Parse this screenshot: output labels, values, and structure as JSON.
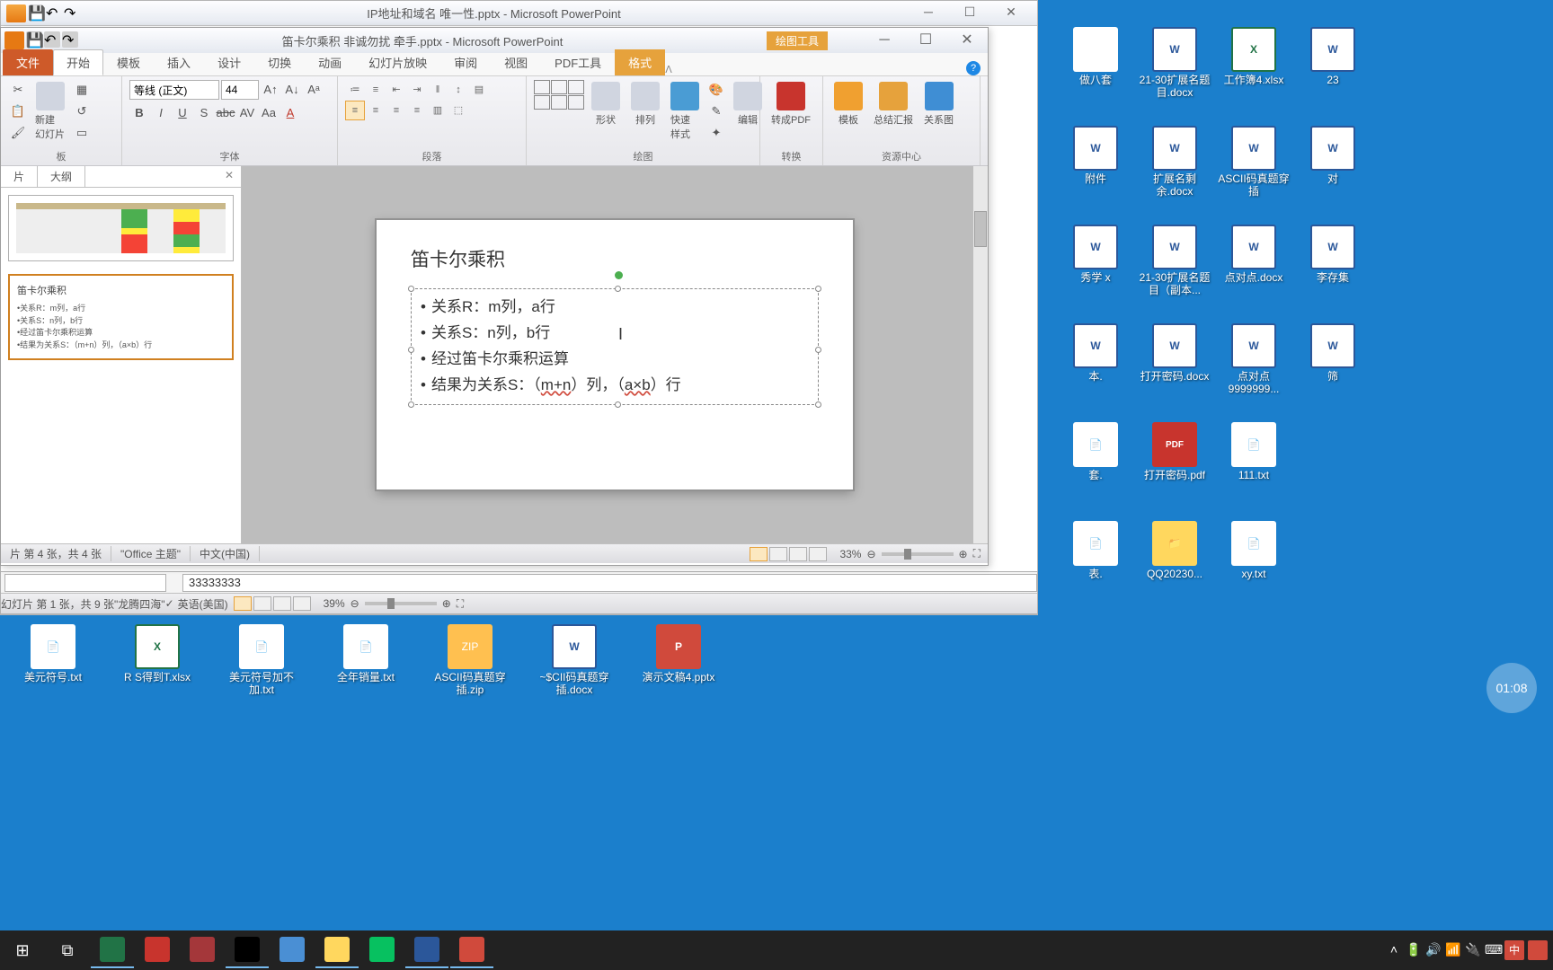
{
  "bgWindow": {
    "title": "IP地址和域名 唯一性.pptx - Microsoft PowerPoint",
    "formula": "33333333",
    "status": {
      "slide": "幻灯片 第 1 张，共 9 张",
      "theme": "\"龙腾四海\"",
      "lang": "英语(美国)",
      "zoom": "39%"
    }
  },
  "fgWindow": {
    "title": "笛卡尔乘积 非诚勿扰 牵手.pptx - Microsoft PowerPoint",
    "contextTab": "绘图工具",
    "tabs": {
      "file": "文件",
      "home": "开始",
      "template": "模板",
      "insert": "插入",
      "design": "设计",
      "transition": "切换",
      "animation": "动画",
      "slideshow": "幻灯片放映",
      "review": "审阅",
      "view": "视图",
      "pdf": "PDF工具",
      "format": "格式"
    },
    "ribbon": {
      "clipboard": {
        "label": "板",
        "paste": "粘贴",
        "newSlide": "新建\n幻灯片"
      },
      "font": {
        "label": "字体",
        "name": "等线 (正文)",
        "size": "44"
      },
      "paragraph": {
        "label": "段落"
      },
      "drawing": {
        "label": "绘图",
        "shapes": "形状",
        "arrange": "排列",
        "quickstyle": "快速样式",
        "edit": "编辑"
      },
      "convert": {
        "label": "转换",
        "topdf": "转成PDF"
      },
      "resource": {
        "label": "资源中心",
        "template": "模板",
        "summary": "总结汇报",
        "relation": "关系图"
      }
    },
    "panelTabs": {
      "slides": "片",
      "outline": "大纲"
    },
    "thumb2": {
      "title": "笛卡尔乘积",
      "l1": "•关系R：m列，a行",
      "l2": "•关系S：n列，b行",
      "l3": "•经过笛卡尔乘积运算",
      "l4": "•结果为关系S：（m+n）列，（a×b）行"
    },
    "slide": {
      "title": "笛卡尔乘积",
      "b1a": "关系R：m列，a行",
      "b2a": "关系S：n列，b行",
      "b3": "经过笛卡尔乘积运算",
      "b4a": "结果为关系S：（",
      "b4b": "m+n",
      "b4c": "）列，（",
      "b4d": "a×b",
      "b4e": "）行"
    },
    "status": {
      "slide": "片 第 4 张，共 4 张",
      "theme": "\"Office 主题\"",
      "lang": "中文(中国)",
      "zoom": "33%"
    }
  },
  "desktopIcons": {
    "r1c1": "做八套",
    "r1c2": "21-30扩展名题目.docx",
    "r1c3": "工作簿4.xlsx",
    "r1c4": "23",
    "r2c1": "附件",
    "r2c2": "扩展名剩余.docx",
    "r2c3": "ASCII码真题穿插",
    "r2c4": "对",
    "r3c1": "秀学 x",
    "r3c2": "21-30扩展名题目（副本...",
    "r3c3": "点对点.docx",
    "r3c4": "李存集",
    "r4c1": "本.",
    "r4c2": "打开密码.docx",
    "r4c3": "点对点9999999...",
    "r4c4": "筛",
    "r5c1": "套.",
    "r5c2": "打开密码.pdf",
    "r5c3": "111.txt",
    "r6c1": "表.",
    "r6c2": "QQ20230...",
    "r6c3": "xy.txt"
  },
  "bottomIcons": {
    "i1": "美元符号.txt",
    "i2": "R S得到T.xlsx",
    "i3": "美元符号加不加.txt",
    "i4": "全年销量.txt",
    "i5": "ASCII码真题穿插.zip",
    "i6": "~$CII码真题穿插.docx",
    "i7": "演示文稿4.pptx"
  },
  "timer": "01:08",
  "tray": {
    "ime": "中"
  }
}
